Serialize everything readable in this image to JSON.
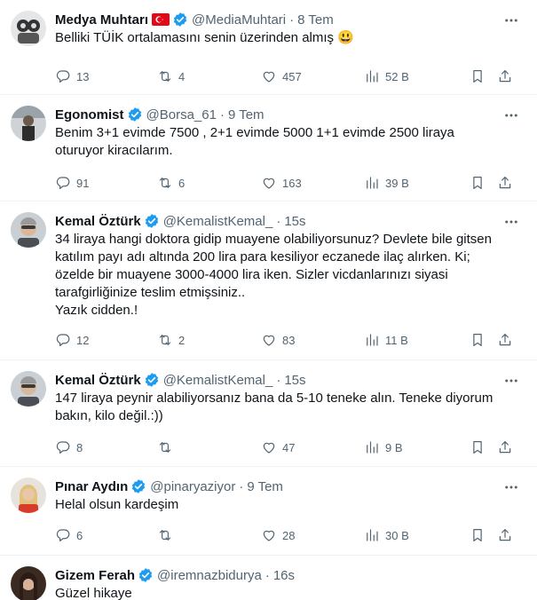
{
  "tweets": [
    {
      "name": "Medya Muhtarı",
      "handle": "@MediaMuhtari",
      "time": "8 Tem",
      "flag": "turkey-flag",
      "lines": [
        "Belliki TÜİK ortalamasını senin üzerinden almış 😃"
      ],
      "replies": "13",
      "retweets": "4",
      "likes": "457",
      "views": "52 B"
    },
    {
      "name": "Egonomist",
      "handle": "@Borsa_61",
      "time": "9 Tem",
      "lines": [
        "Benim 3+1 evimde 7500 , 2+1 evimde 5000  1+1 evimde 2500 liraya",
        "oturuyor kiracılarım."
      ],
      "replies": "91",
      "retweets": "6",
      "likes": "163",
      "views": "39 B"
    },
    {
      "name": "Kemal Öztürk",
      "handle": "@KemalistKemal_",
      "time": "15s",
      "lines": [
        "34 liraya hangi doktora gidip muayene olabiliyorsunuz? Devlete bile gitsen",
        "katılım payı adı altında 200 lira para kesiliyor eczanede ilaç alırken. Ki;",
        "özelde bir muayene 3000-4000 lira iken. Sizler vicdanlarınızı siyasi",
        "tarafgirliğinize teslim etmişsiniz..",
        "Yazık cidden.!"
      ],
      "replies": "12",
      "retweets": "2",
      "likes": "83",
      "views": "11 B"
    },
    {
      "name": "Kemal Öztürk",
      "handle": "@KemalistKemal_",
      "time": "15s",
      "lines": [
        "147 liraya peynir alabiliyorsanız bana da 5-10 teneke alın. Teneke diyorum",
        "bakın, kilo değil.:))"
      ],
      "replies": "8",
      "retweets": "",
      "likes": "47",
      "views": "9 B"
    },
    {
      "name": "Pınar Aydın",
      "handle": "@pinaryaziyor",
      "time": "9 Tem",
      "lines": [
        "Helal olsun kardeşim"
      ],
      "replies": "6",
      "retweets": "",
      "likes": "28",
      "views": "30 B"
    },
    {
      "name": "Gizem Ferah",
      "handle": "@iremnazbidurya",
      "time": "16s",
      "lines": [
        "Güzel hikaye"
      ],
      "replies": "",
      "retweets": "",
      "likes": "",
      "views": ""
    }
  ],
  "colors": {
    "verified": "#1d9bf0",
    "muted": "#536471",
    "text": "#0f1419",
    "divider": "#eff3f4"
  }
}
